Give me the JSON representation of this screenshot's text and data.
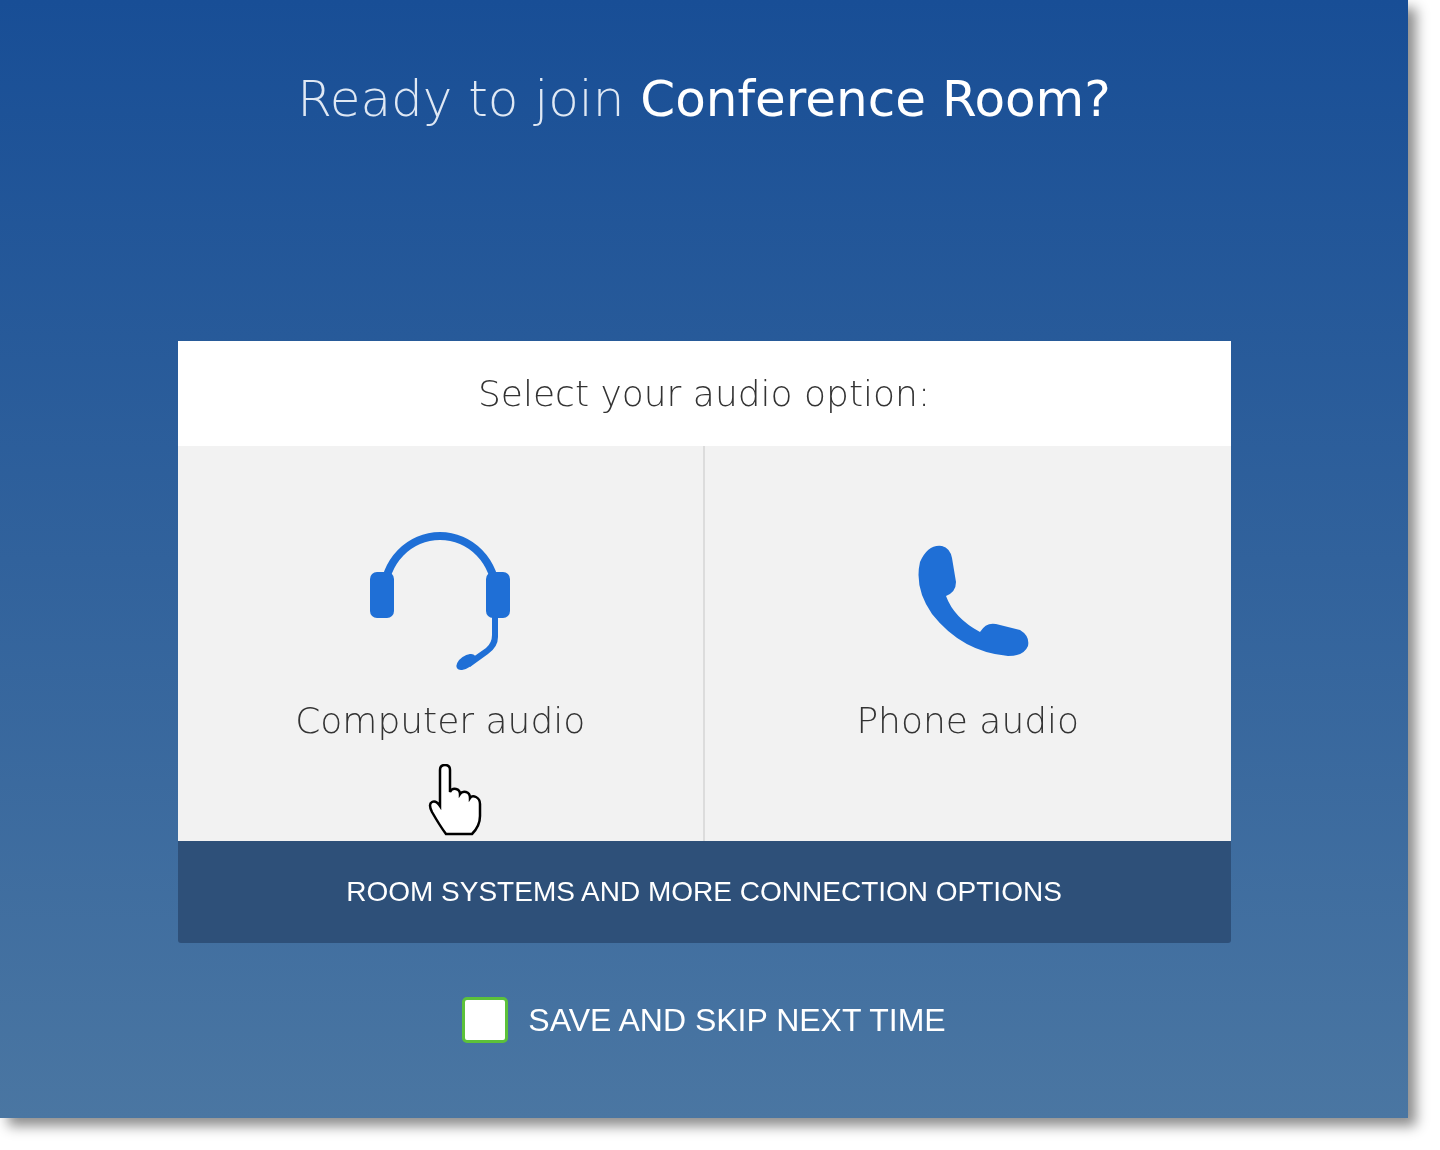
{
  "title": "Ready to join **Conference Room?**",
  "card": {
    "heading": "Select your audio option:",
    "options": [
      {
        "kind": "headset",
        "label": "Computer audio",
        "hovered": true
      },
      {
        "kind": "phone",
        "label": "Phone audio",
        "hovered": false
      }
    ],
    "more_button": "ROOM SYSTEMS AND MORE CONNECTION OPTIONS"
  },
  "save_option": {
    "label": "SAVE AND SKIP NEXT TIME",
    "checked": false
  }
}
